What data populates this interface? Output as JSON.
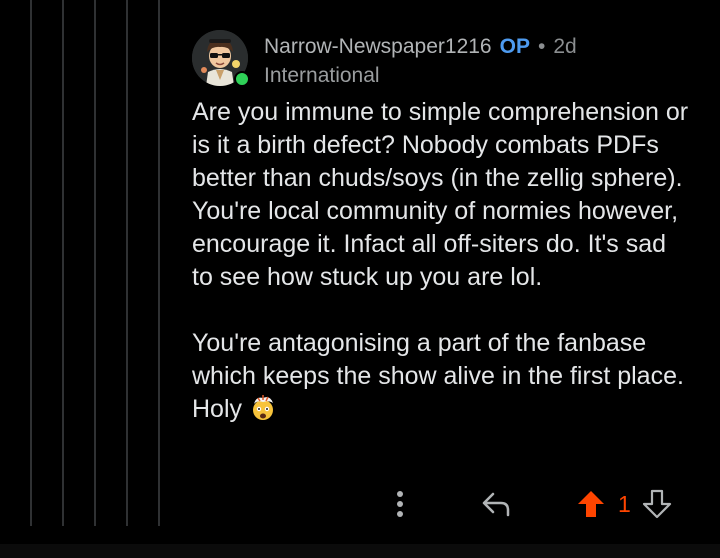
{
  "comment": {
    "author": "Narrow-Newspaper1216",
    "op_badge": "OP",
    "separator": "•",
    "age": "2d",
    "flair": "International",
    "paragraphs": [
      "Are you immune to simple comprehension or is it a birth defect? Nobody combats PDFs better than chuds/soys (in the zellig sphere). You're local community of normies however, encourage it. Infact all off-siters do. It's sad to see how stuck up you are lol.",
      "You're antagonising a part of the fanbase which keeps the show alive in the first place. Holy"
    ],
    "emoji": "exploding-head-emoji",
    "vote_count": "1",
    "upvoted": true
  },
  "icons": {
    "more": "more-options-icon",
    "reply": "reply-icon",
    "upvote": "upvote-arrow-icon",
    "downvote": "downvote-arrow-icon"
  },
  "colors": {
    "background": "#000000",
    "op_badge": "#4e9bf0",
    "upvote_active": "#ff4500",
    "online": "#2fd158",
    "thread_line": "#2f3133"
  }
}
